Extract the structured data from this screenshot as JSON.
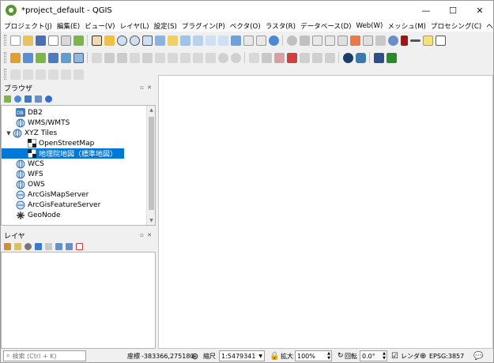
{
  "window": {
    "title": "*project_default - QGIS",
    "minimize": "—",
    "maximize": "☐",
    "close": "✕"
  },
  "menu": [
    "プロジェクト(J)",
    "編集(E)",
    "ビュー(V)",
    "レイヤ(L)",
    "設定(S)",
    "プラグイン(P)",
    "ベクタ(O)",
    "ラスタ(R)",
    "データベース(D)",
    "Web(W)",
    "メッシュ(M)",
    "プロセシング(C)",
    "ヘルプ(H)"
  ],
  "browser": {
    "title": "ブラウザ",
    "float": "▫",
    "close": "✕",
    "items": [
      {
        "label": "DB2",
        "icon": "db2-icon"
      },
      {
        "label": "WMS/WMTS",
        "icon": "wms-icon"
      },
      {
        "label": "XYZ Tiles",
        "icon": "xyz-icon",
        "expanded": "▼"
      },
      {
        "label": "OpenStreetMap",
        "icon": "tile-icon"
      },
      {
        "label": "地理院地図（標準地図）",
        "icon": "tile-icon",
        "selected": true
      },
      {
        "label": "WCS",
        "icon": "wcs-icon"
      },
      {
        "label": "WFS",
        "icon": "wfs-icon"
      },
      {
        "label": "OWS",
        "icon": "ows-icon"
      },
      {
        "label": "ArcGisMapServer",
        "icon": "arcgis-icon"
      },
      {
        "label": "ArcGisFeatureServer",
        "icon": "arcgis-icon"
      },
      {
        "label": "GeoNode",
        "icon": "geonode-icon"
      }
    ]
  },
  "layers": {
    "title": "レイヤ",
    "float": "▫",
    "close": "✕"
  },
  "status": {
    "search_placeholder": "検索 (Ctrl + K)",
    "coord_label": "座標",
    "coord_value": "-383366,275180",
    "scale_label": "縮尺",
    "scale_value": "1:5479341",
    "magnify_label": "拡大",
    "magnify_value": "100%",
    "rotation_label": "回転",
    "rotation_value": "0.0°",
    "render_label": "レンダ",
    "crs": "EPSG:3857"
  },
  "colors": {
    "accent": "#0078d7",
    "qgis_green": "#589632"
  }
}
